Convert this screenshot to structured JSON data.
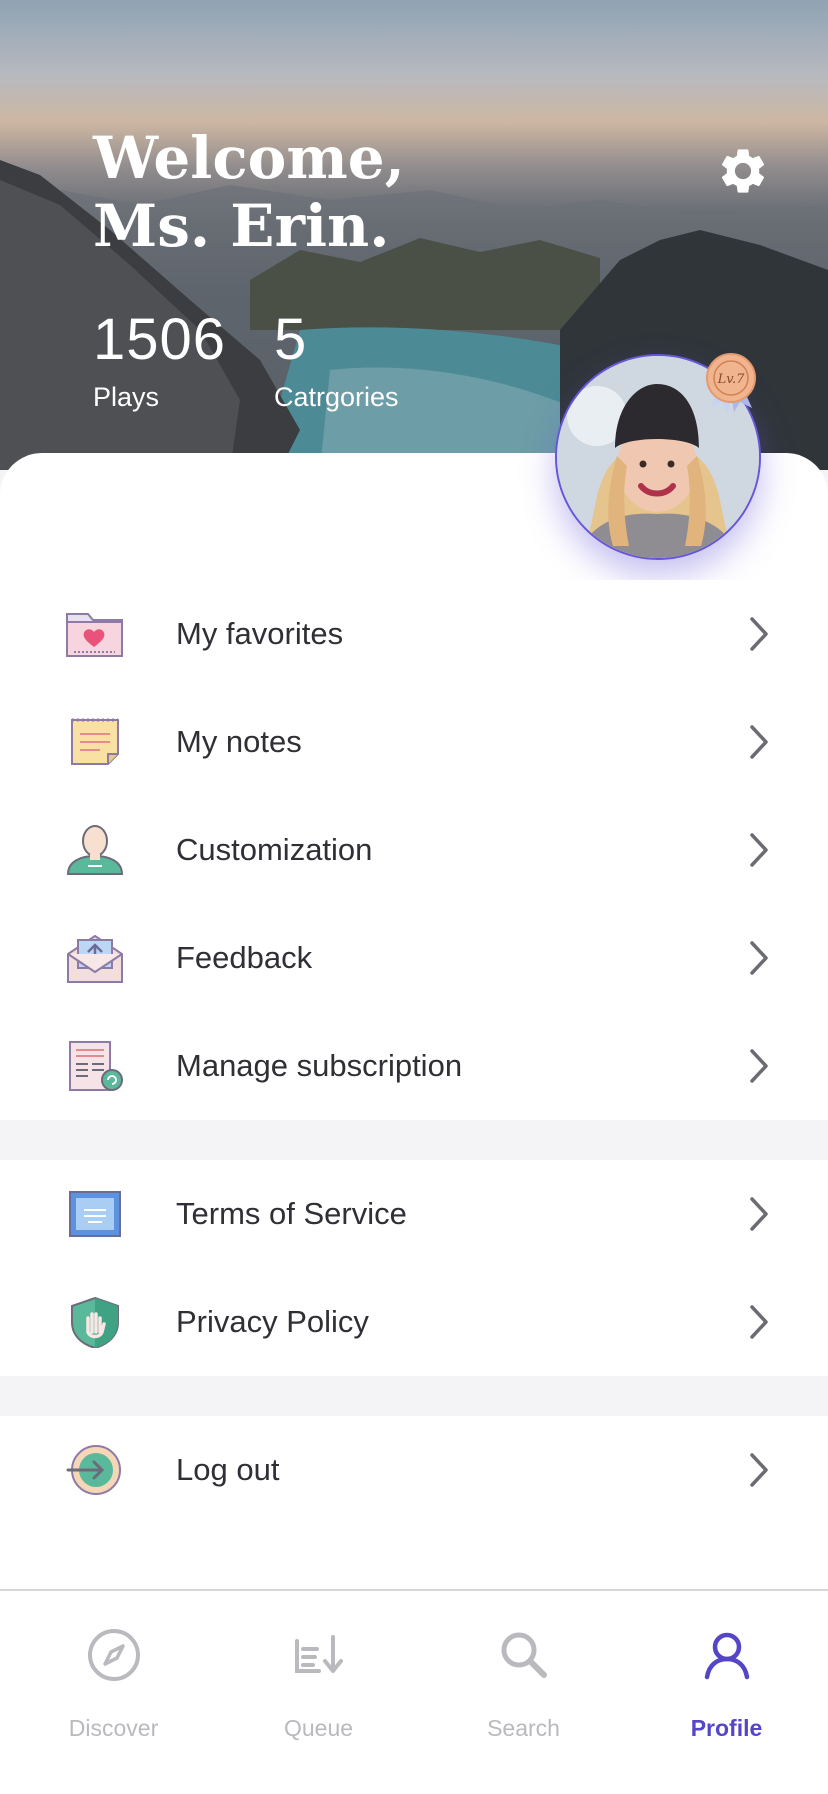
{
  "header": {
    "greeting_line1": "Welcome,",
    "greeting_line2": "Ms. Erin."
  },
  "stats": [
    {
      "value": "1506",
      "label": "Plays"
    },
    {
      "value": "5",
      "label": "Catrgories"
    }
  ],
  "profile": {
    "level_badge": "Lv.7"
  },
  "menu_groups": [
    [
      {
        "label": "My favorites",
        "icon": "favorites-folder-icon"
      },
      {
        "label": "My notes",
        "icon": "notes-icon"
      },
      {
        "label": "Customization",
        "icon": "user-customization-icon"
      },
      {
        "label": "Feedback",
        "icon": "feedback-envelope-icon"
      },
      {
        "label": "Manage subscription",
        "icon": "subscription-icon"
      }
    ],
    [
      {
        "label": "Terms of Service",
        "icon": "terms-document-icon"
      },
      {
        "label": "Privacy Policy",
        "icon": "privacy-shield-icon"
      }
    ],
    [
      {
        "label": "Log out",
        "icon": "logout-icon"
      }
    ]
  ],
  "tabs": [
    {
      "label": "Discover",
      "icon": "compass-icon",
      "active": false
    },
    {
      "label": "Queue",
      "icon": "queue-icon",
      "active": false
    },
    {
      "label": "Search",
      "icon": "search-icon",
      "active": false
    },
    {
      "label": "Profile",
      "icon": "profile-icon",
      "active": true
    }
  ],
  "colors": {
    "accent": "#5446c6",
    "inactive": "#b9b9be",
    "text": "#2f2f35",
    "divider": "#f4f4f6"
  }
}
